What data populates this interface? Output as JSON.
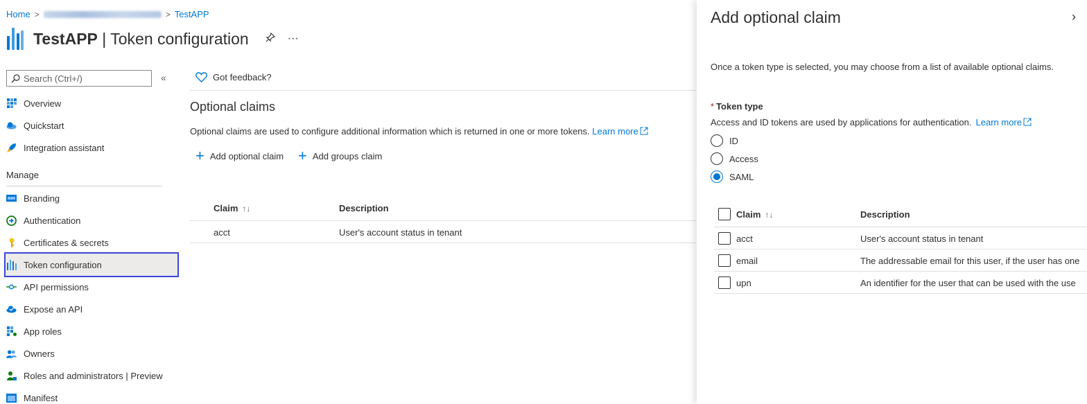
{
  "breadcrumb": {
    "home": "Home",
    "current": "TestAPP"
  },
  "header": {
    "app_name": "TestAPP",
    "separator": "|",
    "page": "Token configuration",
    "more": "···"
  },
  "sidebar": {
    "search_placeholder": "Search (Ctrl+/)",
    "collapse": "«",
    "manage_label": "Manage",
    "items_top": [
      {
        "label": "Overview",
        "icon": "overview-icon"
      },
      {
        "label": "Quickstart",
        "icon": "quickstart-icon"
      },
      {
        "label": "Integration assistant",
        "icon": "rocket-icon"
      }
    ],
    "items_manage": [
      {
        "label": "Branding",
        "icon": "branding-icon"
      },
      {
        "label": "Authentication",
        "icon": "authentication-icon"
      },
      {
        "label": "Certificates & secrets",
        "icon": "key-icon"
      },
      {
        "label": "Token configuration",
        "icon": "token-config-icon",
        "active": true
      },
      {
        "label": "API permissions",
        "icon": "api-permissions-icon"
      },
      {
        "label": "Expose an API",
        "icon": "cloud-icon"
      },
      {
        "label": "App roles",
        "icon": "app-roles-icon"
      },
      {
        "label": "Owners",
        "icon": "owners-icon"
      },
      {
        "label": "Roles and administrators | Preview",
        "icon": "roles-icon"
      },
      {
        "label": "Manifest",
        "icon": "manifest-icon"
      }
    ]
  },
  "main": {
    "feedback": "Got feedback?",
    "section_title": "Optional claims",
    "section_desc": "Optional claims are used to configure additional information which is returned in one or more tokens.",
    "learn_more": "Learn more",
    "add_optional_claim": "Add optional claim",
    "add_groups_claim": "Add groups claim",
    "columns": [
      "Claim",
      "Description"
    ],
    "rows": [
      {
        "claim": "acct",
        "description": "User's account status in tenant"
      }
    ]
  },
  "panel": {
    "title": "Add optional claim",
    "close": "›",
    "intro": "Once a token type is selected, you may choose from a list of available optional claims.",
    "token_type_label": "Token type",
    "required_mark": "*",
    "token_desc": "Access and ID tokens are used by applications for authentication.",
    "learn_more": "Learn more",
    "token_types": [
      {
        "label": "ID",
        "selected": false
      },
      {
        "label": "Access",
        "selected": false
      },
      {
        "label": "SAML",
        "selected": true
      }
    ],
    "columns": [
      "Claim",
      "Description"
    ],
    "rows": [
      {
        "claim": "acct",
        "description": "User's account status in tenant"
      },
      {
        "claim": "email",
        "description": "The addressable email for this user, if the user has one"
      },
      {
        "claim": "upn",
        "description": "An identifier for the user that can be used with the use"
      }
    ]
  },
  "colors": {
    "accent": "#0078d4",
    "active_outline": "#3b46d8",
    "required": "#a4262c"
  }
}
